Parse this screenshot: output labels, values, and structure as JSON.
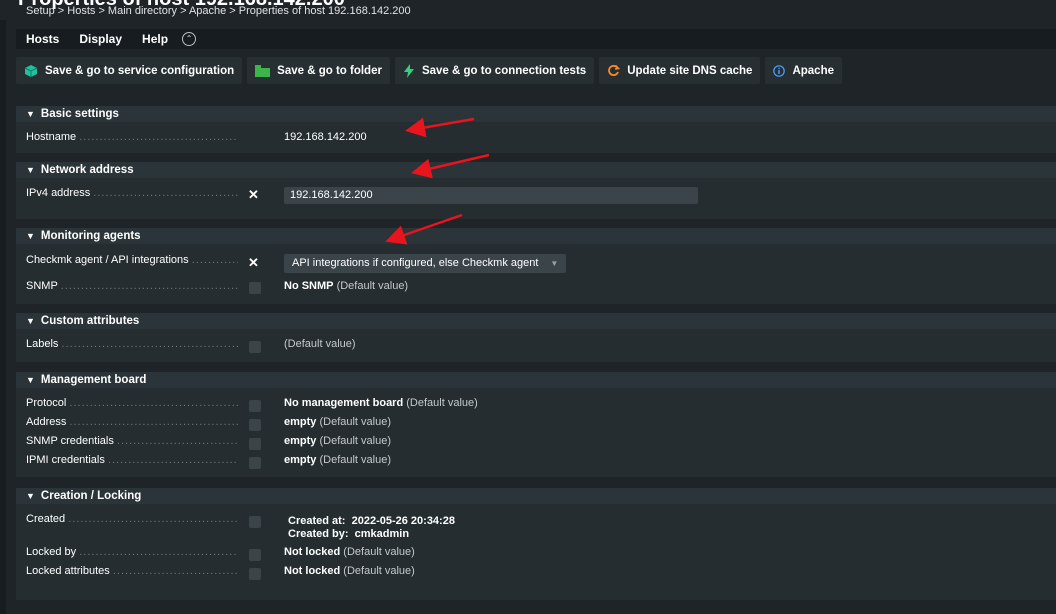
{
  "page": {
    "title": "Properties of host 192.168.142.200",
    "breadcrumb": "Setup > Hosts > Main directory > Apache > Properties of host 192.168.142.200"
  },
  "menu": {
    "items": [
      "Hosts",
      "Display",
      "Help"
    ]
  },
  "toolbar": {
    "save_service": "Save & go to service configuration",
    "save_folder": "Save & go to folder",
    "save_tests": "Save & go to connection tests",
    "update_dns": "Update site DNS cache",
    "apache": "Apache"
  },
  "sections": {
    "basic": {
      "title": "Basic settings",
      "hostname_label": "Hostname",
      "hostname_value": "192.168.142.200"
    },
    "network": {
      "title": "Network address",
      "ipv4_label": "IPv4 address",
      "ipv4_value": "192.168.142.200"
    },
    "monitoring": {
      "title": "Monitoring agents",
      "agent_label": "Checkmk agent / API integrations",
      "agent_value": "API integrations if configured, else Checkmk agent",
      "snmp_label": "SNMP",
      "snmp_value": "No SNMP",
      "snmp_default": "(Default value)"
    },
    "custom": {
      "title": "Custom attributes",
      "labels_label": "Labels",
      "labels_default": "(Default value)"
    },
    "management": {
      "title": "Management board",
      "protocol_label": "Protocol",
      "protocol_value": "No management board",
      "protocol_default": "(Default value)",
      "address_label": "Address",
      "address_value": "empty",
      "address_default": "(Default value)",
      "snmp_cred_label": "SNMP credentials",
      "snmp_cred_value": "empty",
      "snmp_cred_default": "(Default value)",
      "ipmi_label": "IPMI credentials",
      "ipmi_value": "empty",
      "ipmi_default": "(Default value)"
    },
    "creation": {
      "title": "Creation / Locking",
      "created_label": "Created",
      "created_at_key": "Created at:",
      "created_at": "2022-05-26 20:34:28",
      "created_by_key": "Created by:",
      "created_by": "cmkadmin",
      "locked_by_label": "Locked by",
      "locked_by_value": "Not locked",
      "locked_by_default": "(Default value)",
      "locked_attr_label": "Locked attributes",
      "locked_attr_value": "Not locked",
      "locked_attr_default": "(Default value)"
    }
  },
  "colors": {
    "background": "#1e2428",
    "section_header": "#2b3438",
    "section_body": "#262d31",
    "service_icon": "#1fc29c",
    "folder_icon": "#3bb54a",
    "lightning_icon": "#2ed37a",
    "dns_icon": "#f58a2e",
    "info_icon": "#4aa3ff",
    "annotation_arrow": "#e8141e"
  },
  "icons": {
    "service": "cube-icon",
    "folder": "folder-icon",
    "tests": "lightning-icon",
    "dns": "refresh-icon",
    "apache": "info-icon",
    "menu_toggle": "chevron-up-icon",
    "section_toggle": "triangle-down-icon"
  }
}
